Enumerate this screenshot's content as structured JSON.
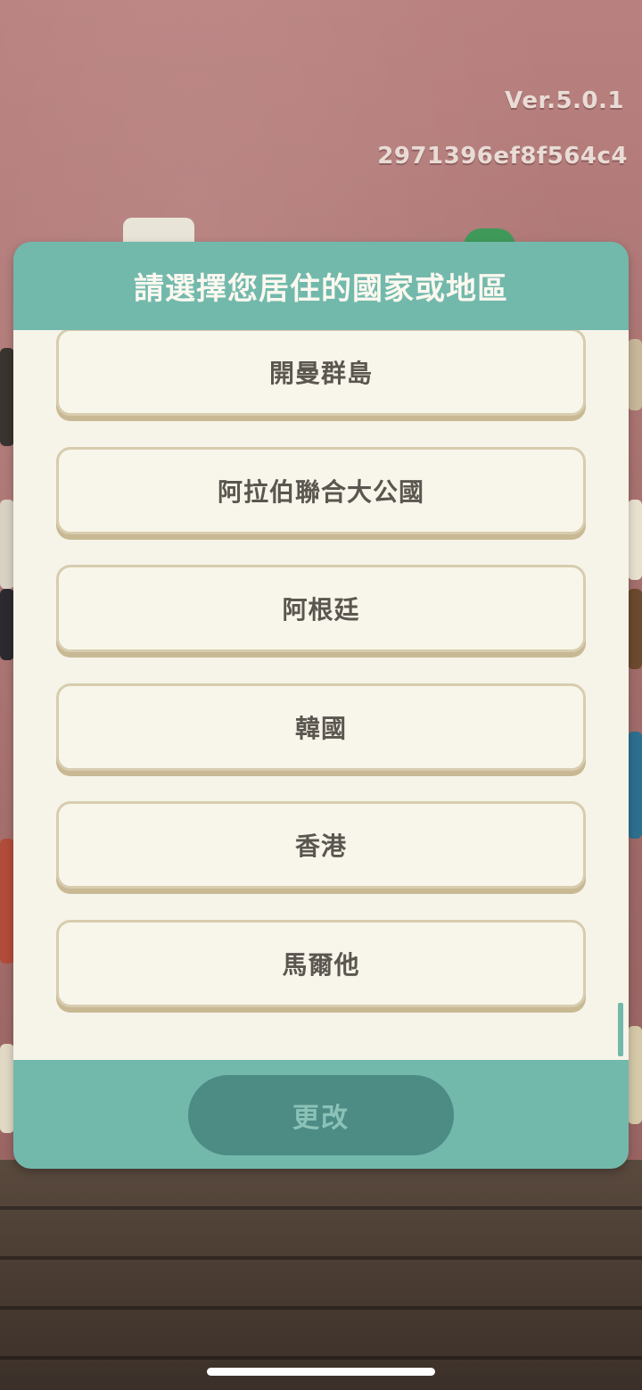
{
  "header": {
    "version": "Ver.5.0.1",
    "build_id": "2971396ef8f564c4"
  },
  "dialog": {
    "title": "請選擇您居住的國家或地區",
    "options": [
      {
        "label": "開曼群島"
      },
      {
        "label": "阿拉伯聯合大公國"
      },
      {
        "label": "阿根廷"
      },
      {
        "label": "韓國"
      },
      {
        "label": "香港"
      },
      {
        "label": "馬爾他"
      }
    ],
    "confirm_label": "更改",
    "confirm_enabled": false
  },
  "colors": {
    "dialog_accent": "#72b9ac",
    "list_background": "#f6f4e9",
    "option_border": "#d8ccaf",
    "option_text": "#5b5650",
    "confirm_button_disabled": "#4d8b85"
  }
}
